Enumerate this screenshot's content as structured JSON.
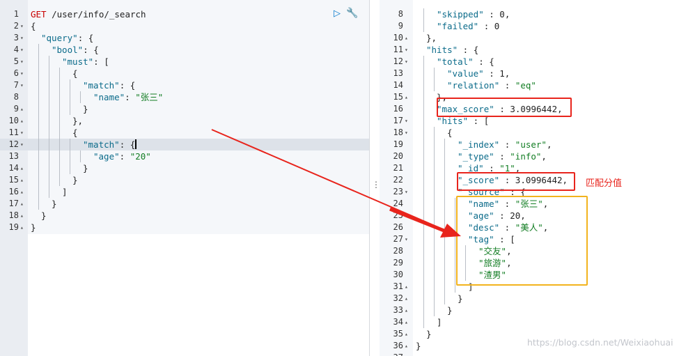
{
  "request": {
    "lines": [
      {
        "n": "1",
        "fold": "",
        "indent": 0,
        "tokens": [
          [
            "method",
            "GET"
          ],
          [
            "punc",
            " /user/info/_search"
          ]
        ]
      },
      {
        "n": "2",
        "fold": "▾",
        "indent": 0,
        "tokens": [
          [
            "punc",
            "{"
          ]
        ]
      },
      {
        "n": "3",
        "fold": "▾",
        "indent": 1,
        "tokens": [
          [
            "key",
            "\"query\""
          ],
          [
            "punc",
            ": {"
          ]
        ]
      },
      {
        "n": "4",
        "fold": "▾",
        "indent": 2,
        "tokens": [
          [
            "key",
            "\"bool\""
          ],
          [
            "punc",
            ": {"
          ]
        ]
      },
      {
        "n": "5",
        "fold": "▾",
        "indent": 3,
        "tokens": [
          [
            "key",
            "\"must\""
          ],
          [
            "punc",
            ": ["
          ]
        ]
      },
      {
        "n": "6",
        "fold": "▾",
        "indent": 4,
        "tokens": [
          [
            "punc",
            "{"
          ]
        ]
      },
      {
        "n": "7",
        "fold": "▾",
        "indent": 5,
        "tokens": [
          [
            "key",
            "\"match\""
          ],
          [
            "punc",
            ": {"
          ]
        ]
      },
      {
        "n": "8",
        "fold": "",
        "indent": 6,
        "tokens": [
          [
            "key",
            "\"name\""
          ],
          [
            "punc",
            ": "
          ],
          [
            "str",
            "\"张三\""
          ]
        ]
      },
      {
        "n": "9",
        "fold": "▴",
        "indent": 5,
        "tokens": [
          [
            "punc",
            "}"
          ]
        ]
      },
      {
        "n": "10",
        "fold": "▴",
        "indent": 4,
        "tokens": [
          [
            "punc",
            "},"
          ]
        ]
      },
      {
        "n": "11",
        "fold": "▾",
        "indent": 4,
        "tokens": [
          [
            "punc",
            "{"
          ]
        ]
      },
      {
        "n": "12",
        "fold": "▾",
        "indent": 5,
        "tokens": [
          [
            "key",
            "\"match\""
          ],
          [
            "punc",
            ": {"
          ]
        ]
      },
      {
        "n": "13",
        "fold": "",
        "indent": 6,
        "tokens": [
          [
            "key",
            "\"age\""
          ],
          [
            "punc",
            ": "
          ],
          [
            "str",
            "\"20\""
          ]
        ]
      },
      {
        "n": "14",
        "fold": "▴",
        "indent": 5,
        "tokens": [
          [
            "punc",
            "}"
          ]
        ]
      },
      {
        "n": "15",
        "fold": "▴",
        "indent": 4,
        "tokens": [
          [
            "punc",
            "}"
          ]
        ]
      },
      {
        "n": "16",
        "fold": "▴",
        "indent": 3,
        "tokens": [
          [
            "punc",
            "]"
          ]
        ]
      },
      {
        "n": "17",
        "fold": "▴",
        "indent": 2,
        "tokens": [
          [
            "punc",
            "}"
          ]
        ]
      },
      {
        "n": "18",
        "fold": "▴",
        "indent": 1,
        "tokens": [
          [
            "punc",
            "}"
          ]
        ]
      },
      {
        "n": "19",
        "fold": "▴",
        "indent": 0,
        "tokens": [
          [
            "punc",
            "}"
          ]
        ]
      }
    ],
    "active_line": "12",
    "run_icon": "▷",
    "wrench_icon": "🔧"
  },
  "response": {
    "lines": [
      {
        "n": "8",
        "fold": "",
        "indent": 2,
        "tokens": [
          [
            "key",
            "\"skipped\""
          ],
          [
            "punc",
            " : 0,"
          ]
        ]
      },
      {
        "n": "9",
        "fold": "",
        "indent": 2,
        "tokens": [
          [
            "key",
            "\"failed\""
          ],
          [
            "punc",
            " : 0"
          ]
        ]
      },
      {
        "n": "10",
        "fold": "▴",
        "indent": 1,
        "tokens": [
          [
            "punc",
            "},"
          ]
        ]
      },
      {
        "n": "11",
        "fold": "▾",
        "indent": 1,
        "tokens": [
          [
            "key",
            "\"hits\""
          ],
          [
            "punc",
            " : {"
          ]
        ]
      },
      {
        "n": "12",
        "fold": "▾",
        "indent": 2,
        "tokens": [
          [
            "key",
            "\"total\""
          ],
          [
            "punc",
            " : {"
          ]
        ]
      },
      {
        "n": "13",
        "fold": "",
        "indent": 3,
        "tokens": [
          [
            "key",
            "\"value\""
          ],
          [
            "punc",
            " : 1,"
          ]
        ]
      },
      {
        "n": "14",
        "fold": "",
        "indent": 3,
        "tokens": [
          [
            "key",
            "\"relation\""
          ],
          [
            "punc",
            " : "
          ],
          [
            "str",
            "\"eq\""
          ]
        ]
      },
      {
        "n": "15",
        "fold": "▴",
        "indent": 2,
        "tokens": [
          [
            "punc",
            "},"
          ]
        ]
      },
      {
        "n": "16",
        "fold": "",
        "indent": 2,
        "tokens": [
          [
            "key",
            "\"max_score\""
          ],
          [
            "punc",
            " : 3.0996442,"
          ]
        ]
      },
      {
        "n": "17",
        "fold": "▾",
        "indent": 2,
        "tokens": [
          [
            "key",
            "\"hits\""
          ],
          [
            "punc",
            " : ["
          ]
        ]
      },
      {
        "n": "18",
        "fold": "▾",
        "indent": 3,
        "tokens": [
          [
            "punc",
            "{"
          ]
        ]
      },
      {
        "n": "19",
        "fold": "",
        "indent": 4,
        "tokens": [
          [
            "key",
            "\"_index\""
          ],
          [
            "punc",
            " : "
          ],
          [
            "str",
            "\"user\""
          ],
          [
            "punc",
            ","
          ]
        ]
      },
      {
        "n": "20",
        "fold": "",
        "indent": 4,
        "tokens": [
          [
            "key",
            "\"_type\""
          ],
          [
            "punc",
            " : "
          ],
          [
            "str",
            "\"info\""
          ],
          [
            "punc",
            ","
          ]
        ]
      },
      {
        "n": "21",
        "fold": "",
        "indent": 4,
        "tokens": [
          [
            "key",
            "\"_id\""
          ],
          [
            "punc",
            " : "
          ],
          [
            "str",
            "\"1\""
          ],
          [
            "punc",
            ","
          ]
        ]
      },
      {
        "n": "22",
        "fold": "",
        "indent": 4,
        "tokens": [
          [
            "key",
            "\"_score\""
          ],
          [
            "punc",
            " : 3.0996442,"
          ]
        ]
      },
      {
        "n": "23",
        "fold": "▾",
        "indent": 4,
        "tokens": [
          [
            "key",
            "\"_source\""
          ],
          [
            "punc",
            " : {"
          ]
        ]
      },
      {
        "n": "24",
        "fold": "",
        "indent": 5,
        "tokens": [
          [
            "key",
            "\"name\""
          ],
          [
            "punc",
            " : "
          ],
          [
            "str",
            "\"张三\""
          ],
          [
            "punc",
            ","
          ]
        ]
      },
      {
        "n": "25",
        "fold": "",
        "indent": 5,
        "tokens": [
          [
            "key",
            "\"age\""
          ],
          [
            "punc",
            " : 20,"
          ]
        ]
      },
      {
        "n": "26",
        "fold": "",
        "indent": 5,
        "tokens": [
          [
            "key",
            "\"desc\""
          ],
          [
            "punc",
            " : "
          ],
          [
            "str",
            "\"美人\""
          ],
          [
            "punc",
            ","
          ]
        ]
      },
      {
        "n": "27",
        "fold": "▾",
        "indent": 5,
        "tokens": [
          [
            "key",
            "\"tag\""
          ],
          [
            "punc",
            " : ["
          ]
        ]
      },
      {
        "n": "28",
        "fold": "",
        "indent": 6,
        "tokens": [
          [
            "str",
            "\"交友\""
          ],
          [
            "punc",
            ","
          ]
        ]
      },
      {
        "n": "29",
        "fold": "",
        "indent": 6,
        "tokens": [
          [
            "str",
            "\"旅游\""
          ],
          [
            "punc",
            ","
          ]
        ]
      },
      {
        "n": "30",
        "fold": "",
        "indent": 6,
        "tokens": [
          [
            "str",
            "\"渣男\""
          ]
        ]
      },
      {
        "n": "31",
        "fold": "▴",
        "indent": 5,
        "tokens": [
          [
            "punc",
            "]"
          ]
        ]
      },
      {
        "n": "32",
        "fold": "▴",
        "indent": 4,
        "tokens": [
          [
            "punc",
            "}"
          ]
        ]
      },
      {
        "n": "33",
        "fold": "▴",
        "indent": 3,
        "tokens": [
          [
            "punc",
            "}"
          ]
        ]
      },
      {
        "n": "34",
        "fold": "▴",
        "indent": 2,
        "tokens": [
          [
            "punc",
            "]"
          ]
        ]
      },
      {
        "n": "35",
        "fold": "▴",
        "indent": 1,
        "tokens": [
          [
            "punc",
            "}"
          ]
        ]
      },
      {
        "n": "36",
        "fold": "▴",
        "indent": 0,
        "tokens": [
          [
            "punc",
            "}"
          ]
        ]
      },
      {
        "n": "37",
        "fold": "",
        "indent": 0,
        "tokens": []
      }
    ]
  },
  "annotation": {
    "label": "匹配分值",
    "red": "#e8241c",
    "yellow": "#f2b31e"
  },
  "watermark": "https://blog.csdn.net/Weixiaohuai",
  "divider_handle": "⋮"
}
